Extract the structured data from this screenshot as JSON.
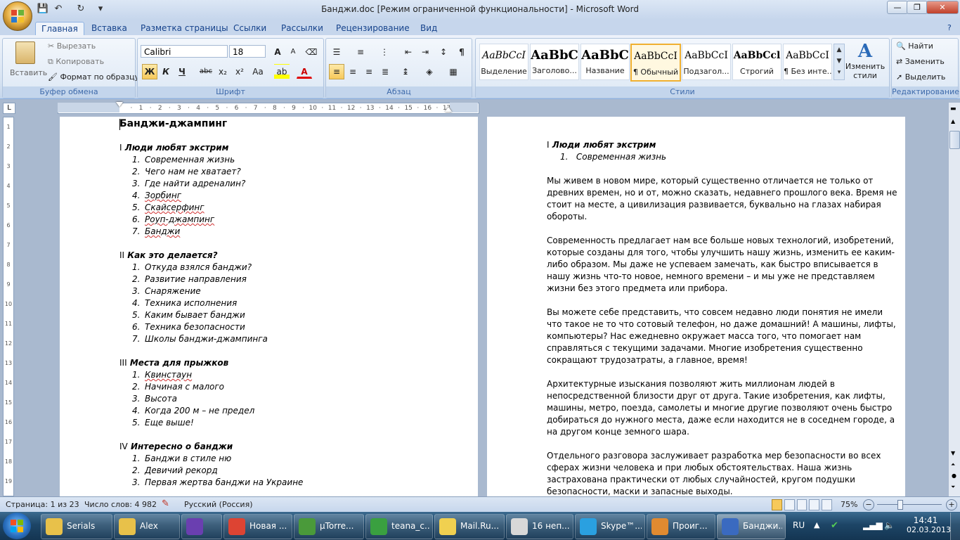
{
  "window": {
    "title": "Банджи.doc [Режим ограниченной функциональности] - Microsoft Word",
    "min": "—",
    "max": "❐",
    "close": "✕"
  },
  "tabs": [
    "Главная",
    "Вставка",
    "Разметка страницы",
    "Ссылки",
    "Рассылки",
    "Рецензирование",
    "Вид"
  ],
  "clipboard": {
    "paste": "Вставить",
    "cut": "Вырезать",
    "copy": "Копировать",
    "format": "Формат по образцу",
    "label": "Буфер обмена"
  },
  "font": {
    "name": "Calibri",
    "size": "18",
    "label": "Шрифт",
    "grow": "A",
    "shrink": "A",
    "bold": "Ж",
    "italic": "К",
    "underline": "Ч",
    "strike": "abc",
    "sub": "x₂",
    "sup": "x²",
    "case": "Aa"
  },
  "paragraph": {
    "label": "Абзац",
    "pilcrow": "¶"
  },
  "styles": {
    "label": "Стили",
    "items": [
      {
        "preview": "AaBbCcI",
        "name": "Выделение"
      },
      {
        "preview": "AaBbC",
        "name": "Заголово..."
      },
      {
        "preview": "AaBbC",
        "name": "Название"
      },
      {
        "preview": "AaBbCcI",
        "name": "¶ Обычный"
      },
      {
        "preview": "AaBbCcI",
        "name": "Подзагол..."
      },
      {
        "preview": "AaBbCcl",
        "name": "Строгий"
      },
      {
        "preview": "AaBbCcI",
        "name": "¶ Без инте..."
      }
    ],
    "change_line1": "Изменить",
    "change_line2": "стили"
  },
  "editing": {
    "find": "Найти",
    "replace": "Заменить",
    "select": "Выделить",
    "label": "Редактирование"
  },
  "ruler": {
    "ticks": [
      "3",
      "·",
      "2",
      "·",
      "1",
      "·",
      "",
      "·",
      "1",
      "·",
      "2",
      "·",
      "3",
      "·",
      "4",
      "·",
      "5",
      "·",
      "6",
      "·",
      "7",
      "·",
      "8",
      "·",
      "9",
      "·",
      "10",
      "·",
      "11",
      "·",
      "12",
      "·",
      "13",
      "·",
      "14",
      "·",
      "15",
      "·",
      "16",
      "·",
      "17",
      "·"
    ],
    "vticks": [
      "1",
      "2",
      "3",
      "4",
      "5",
      "6",
      "7",
      "8",
      "9",
      "10",
      "11",
      "12",
      "13",
      "14",
      "15",
      "16",
      "17",
      "18",
      "19"
    ]
  },
  "page1": {
    "title": "Банджи-джампинг",
    "sections": [
      {
        "num": "I",
        "title": "Люди любят экстрим",
        "items": [
          "Современная жизнь",
          "Чего нам не хватает?",
          "Где найти адреналин?",
          "Зорбинг",
          "Скайсерфинг",
          "Роуп-джампинг",
          "Банджи"
        ]
      },
      {
        "num": "II",
        "title": "Как это делается?",
        "items": [
          "Откуда взялся банджи?",
          "Развитие направления",
          "Снаряжение",
          "Техника исполнения",
          "Каким бывает банджи",
          "Техника безопасности",
          "Школы банджи-джампинга"
        ]
      },
      {
        "num": "III",
        "title": "Места для прыжков",
        "items": [
          "Квинстаун",
          "Начиная с малого",
          "Высота",
          "Когда 200 м – не предел",
          "Еще выше!"
        ]
      },
      {
        "num": "IV",
        "title": "Интересно о банджи",
        "items": [
          "Банджи в стиле ню",
          "Девичий рекорд",
          "Первая жертва банджи на Украине"
        ]
      }
    ]
  },
  "page2": {
    "sec_num": "I",
    "sec_title": "Люди любят экстрим",
    "item1": "Современная жизнь",
    "paragraphs": [
      [
        "Мы живем в новом мире, который  существенно отличается не только от",
        "древних времен, но и от, можно сказать, недавнего прошлого века. Время не",
        "стоит на месте, а цивилизация развивается, буквально на глазах набирая",
        "обороты."
      ],
      [
        "Современность предлагает нам все больше новых технологий, изобретений,",
        "которые созданы для того, чтобы улучшить нашу жизнь, изменить ее каким-",
        "либо образом. Мы даже не успеваем замечать, как быстро вписывается в",
        "нашу жизнь что-то новое, немного времени – и мы уже не представляем",
        "жизни без этого предмета или прибора."
      ],
      [
        "Вы можете себе представить, что совсем недавно люди понятия не имели",
        "что такое не то что сотовый телефон, но даже домашний! А машины, лифты,",
        "компьютеры? Нас ежедневно окружает масса того, что помогает нам",
        "справляться с текущими задачами. Многие изобретения существенно",
        "сокращают трудозатраты,  а главное, время!"
      ],
      [
        "Архитектурные изыскания позволяют жить миллионам людей в",
        "непосредственной близости друг от друга. Такие изобретения, как лифты,",
        "машины, метро, поезда, самолеты и многие другие позволяют очень быстро",
        "добираться до нужного места, даже если находится не в соседнем городе, а",
        "на другом конце земного шара."
      ],
      [
        "Отдельного разговора заслуживает разработка мер безопасности во всех",
        "сферах жизни человека и при любых обстоятельствах.  Наша жизнь",
        "застрахована практически от любых случайностей, кругом подушки",
        "безопасности, маски и запасные выходы."
      ]
    ]
  },
  "status": {
    "page": "Страница: 1 из 23",
    "words": "Число слов: 4 982",
    "lang": "Русский (Россия)",
    "zoom": "75%"
  },
  "taskbar": {
    "items": [
      {
        "label": "Serials",
        "color": "#e8c14a"
      },
      {
        "label": "Alex",
        "color": "#e8c14a"
      },
      {
        "label": "",
        "color": "#6a3fb0"
      },
      {
        "label": "Новая ...",
        "color": "#dd4433"
      },
      {
        "label": "µTorre...",
        "color": "#4a9a3a"
      },
      {
        "label": "teana_c...",
        "color": "#3aa040"
      },
      {
        "label": "Mail.Ru...",
        "color": "#f0d050"
      },
      {
        "label": "16 неп...",
        "color": "#d8d8d8"
      },
      {
        "label": "Skype™...",
        "color": "#2aa0e0"
      },
      {
        "label": "Проиг...",
        "color": "#e08a30"
      },
      {
        "label": "Банджи...",
        "color": "#3a6ac0"
      }
    ],
    "lang": "RU",
    "time": "14:41",
    "date": "02.03.2013"
  }
}
